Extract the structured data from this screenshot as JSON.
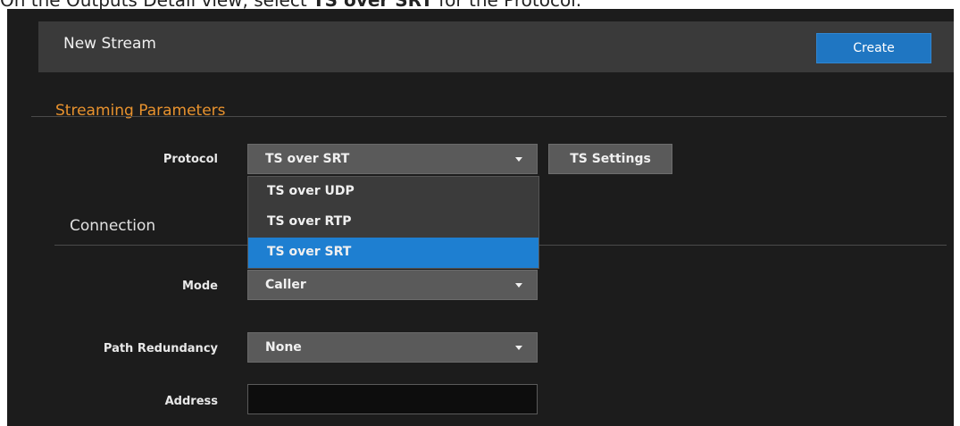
{
  "instruction": {
    "prefix": "On the Outputs Detail view, select ",
    "bold": "TS over SRT",
    "suffix": " for the Protocol."
  },
  "header": {
    "title": "New Stream",
    "create_label": "Create"
  },
  "streaming_parameters": {
    "title": "Streaming Parameters",
    "protocol": {
      "label": "Protocol",
      "value": "TS over SRT",
      "options": [
        "TS over UDP",
        "TS over RTP",
        "TS over SRT"
      ],
      "selected_index": 2
    },
    "ts_settings_label": "TS Settings"
  },
  "connection": {
    "title": "Connection",
    "mode": {
      "label": "Mode",
      "value": "Caller"
    },
    "path_redundancy": {
      "label": "Path Redundancy",
      "value": "None"
    },
    "address": {
      "label": "Address",
      "value": ""
    }
  },
  "colors": {
    "accent": "#1e7fd1",
    "section_title": "#e8922e",
    "background": "#1c1c1c"
  }
}
